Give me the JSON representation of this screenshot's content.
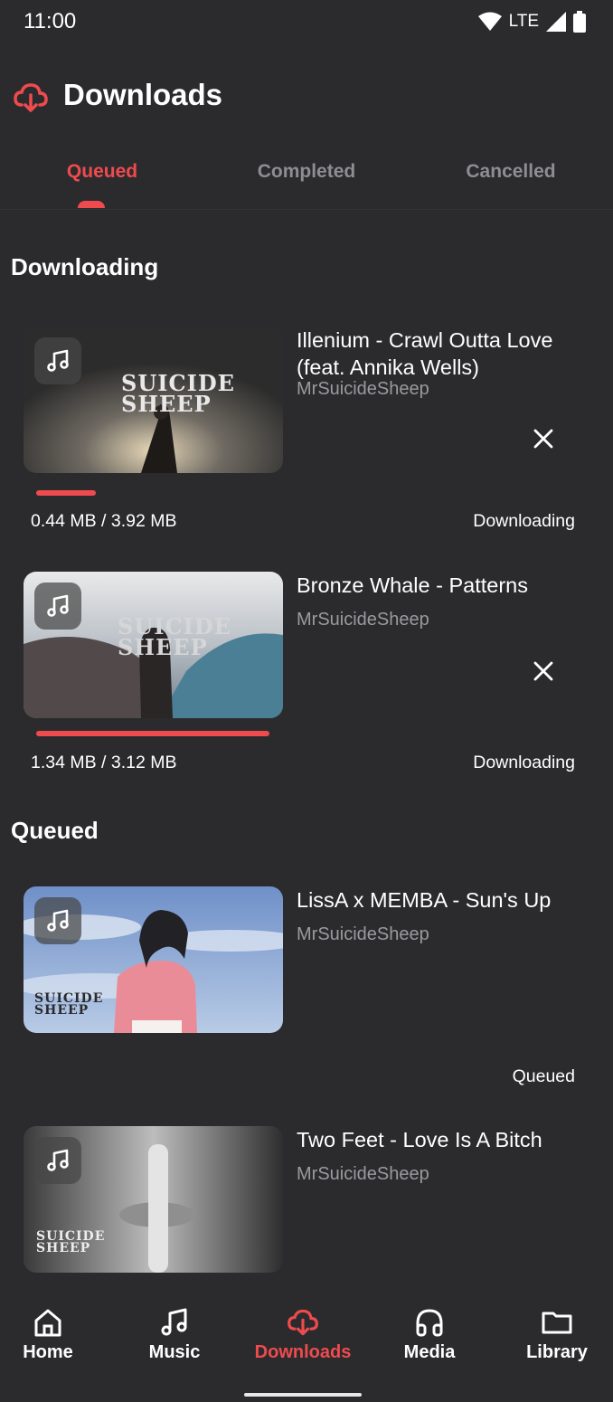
{
  "status_bar": {
    "time": "11:00",
    "network": "LTE"
  },
  "header": {
    "title": "Downloads"
  },
  "tabs": [
    {
      "label": "Queued",
      "active": true
    },
    {
      "label": "Completed",
      "active": false
    },
    {
      "label": "Cancelled",
      "active": false
    }
  ],
  "sections": {
    "downloading": "Downloading",
    "queued": "Queued"
  },
  "downloading": [
    {
      "title": "Illenium - Crawl Outta Love (feat. Annika Wells)",
      "artist": "MrSuicideSheep",
      "size": "0.44 MB / 3.92 MB",
      "status": "Downloading",
      "progress": 0.11,
      "brand": [
        "SUICIDE",
        "SHEEP"
      ]
    },
    {
      "title": "Bronze Whale - Patterns",
      "artist": "MrSuicideSheep",
      "size": "1.34 MB / 3.12 MB",
      "status": "Downloading",
      "progress": 0.43,
      "brand": [
        "SUICIDE",
        "SHEEP"
      ]
    }
  ],
  "queued": [
    {
      "title": "LissA x MEMBA - Sun's Up",
      "artist": "MrSuicideSheep",
      "status": "Queued",
      "brand": [
        "SUICIDE",
        "SHEEP"
      ]
    },
    {
      "title": "Two Feet - Love Is A Bitch",
      "artist": "MrSuicideSheep",
      "brand": [
        "SUICIDE",
        "SHEEP"
      ]
    }
  ],
  "bottom_nav": [
    {
      "label": "Home",
      "icon": "home-icon",
      "active": false
    },
    {
      "label": "Music",
      "icon": "music-note-icon",
      "active": false
    },
    {
      "label": "Downloads",
      "icon": "cloud-download-icon",
      "active": true
    },
    {
      "label": "Media",
      "icon": "headphones-icon",
      "active": false
    },
    {
      "label": "Library",
      "icon": "folder-icon",
      "active": false
    }
  ],
  "colors": {
    "accent": "#ef4b4f",
    "background": "#2b2b2d",
    "muted_text": "#9a9a9e"
  }
}
